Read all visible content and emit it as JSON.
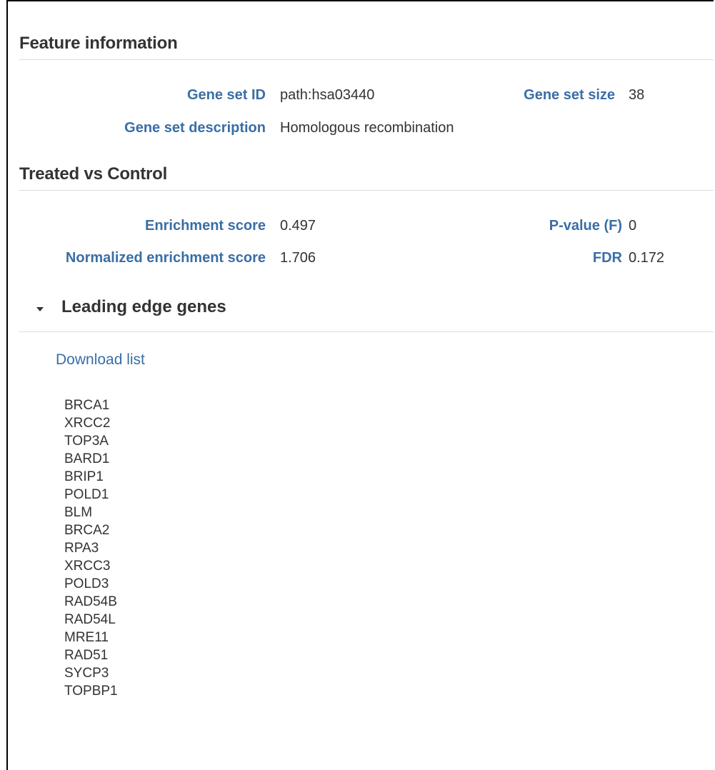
{
  "feature_info": {
    "title": "Feature information",
    "gene_set_id_label": "Gene set ID",
    "gene_set_id_value": "path:hsa03440",
    "gene_set_size_label": "Gene set size",
    "gene_set_size_value": "38",
    "gene_set_description_label": "Gene set description",
    "gene_set_description_value": "Homologous recombination"
  },
  "comparison": {
    "title": "Treated vs Control",
    "enrichment_score_label": "Enrichment score",
    "enrichment_score_value": "0.497",
    "pvalue_label": "P-value (F)",
    "pvalue_value": "0",
    "nes_label": "Normalized enrichment score",
    "nes_value": "1.706",
    "fdr_label": "FDR",
    "fdr_value": "0.172"
  },
  "leading_edge": {
    "title": "Leading edge genes",
    "expanded": true,
    "download_label": "Download list",
    "genes": [
      "BRCA1",
      "XRCC2",
      "TOP3A",
      "BARD1",
      "BRIP1",
      "POLD1",
      "BLM",
      "BRCA2",
      "RPA3",
      "XRCC3",
      "POLD3",
      "RAD54B",
      "RAD54L",
      "MRE11",
      "RAD51",
      "SYCP3",
      "TOPBP1"
    ]
  },
  "colors": {
    "label_blue": "#3a6ea5",
    "text": "#333333",
    "rule": "#dddddd"
  },
  "icons": {
    "caret": "caret-down-icon"
  }
}
